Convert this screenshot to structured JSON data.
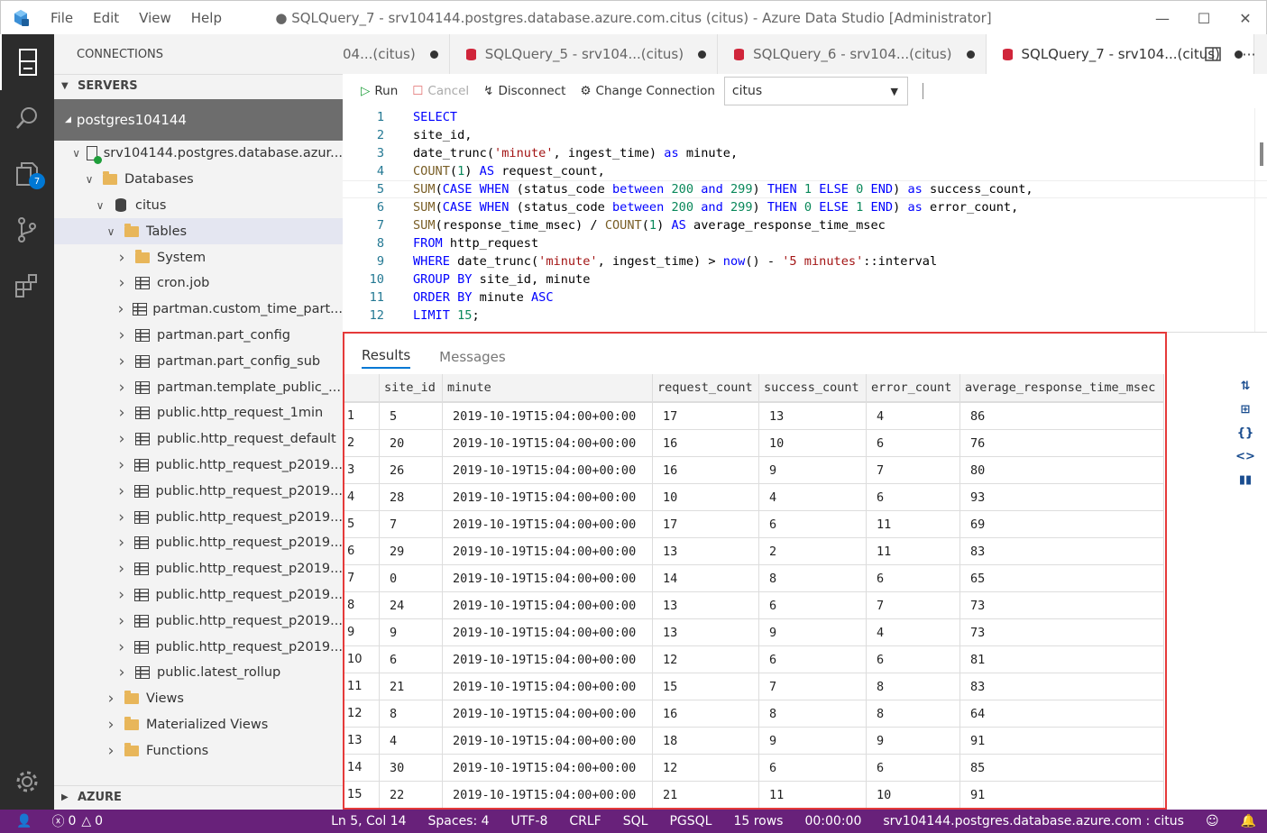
{
  "titlebar": {
    "menu": [
      "File",
      "Edit",
      "View",
      "Help"
    ],
    "title": "● SQLQuery_7 - srv104144.postgres.database.azure.com.citus (citus) - Azure Data Studio [Administrator]"
  },
  "activity": {
    "badge_count": "7"
  },
  "sidebar": {
    "header": "CONNECTIONS",
    "servers_label": "SERVERS",
    "server_group": "postgres104144",
    "tree": [
      {
        "label": "srv104144.postgres.database.azur...",
        "icon": "server-icon",
        "indent": 20,
        "twist": "expanded"
      },
      {
        "label": "Databases",
        "icon": "folder-icon",
        "indent": 32,
        "twist": "expanded"
      },
      {
        "label": "citus",
        "icon": "database-icon",
        "indent": 44,
        "twist": "expanded"
      },
      {
        "label": "Tables",
        "icon": "folder-icon",
        "indent": 56,
        "twist": "expanded",
        "selected": true
      },
      {
        "label": "System",
        "icon": "folder-icon",
        "indent": 68,
        "twist": "collapsed"
      },
      {
        "label": "cron.job",
        "icon": "table-icon",
        "indent": 68,
        "twist": "collapsed"
      },
      {
        "label": "partman.custom_time_part...",
        "icon": "table-icon",
        "indent": 68,
        "twist": "collapsed"
      },
      {
        "label": "partman.part_config",
        "icon": "table-icon",
        "indent": 68,
        "twist": "collapsed"
      },
      {
        "label": "partman.part_config_sub",
        "icon": "table-icon",
        "indent": 68,
        "twist": "collapsed"
      },
      {
        "label": "partman.template_public_...",
        "icon": "table-icon",
        "indent": 68,
        "twist": "collapsed"
      },
      {
        "label": "public.http_request_1min",
        "icon": "table-icon",
        "indent": 68,
        "twist": "collapsed"
      },
      {
        "label": "public.http_request_default",
        "icon": "table-icon",
        "indent": 68,
        "twist": "collapsed"
      },
      {
        "label": "public.http_request_p2019...",
        "icon": "table-icon",
        "indent": 68,
        "twist": "collapsed"
      },
      {
        "label": "public.http_request_p2019...",
        "icon": "table-icon",
        "indent": 68,
        "twist": "collapsed"
      },
      {
        "label": "public.http_request_p2019...",
        "icon": "table-icon",
        "indent": 68,
        "twist": "collapsed"
      },
      {
        "label": "public.http_request_p2019...",
        "icon": "table-icon",
        "indent": 68,
        "twist": "collapsed"
      },
      {
        "label": "public.http_request_p2019...",
        "icon": "table-icon",
        "indent": 68,
        "twist": "collapsed"
      },
      {
        "label": "public.http_request_p2019...",
        "icon": "table-icon",
        "indent": 68,
        "twist": "collapsed"
      },
      {
        "label": "public.http_request_p2019...",
        "icon": "table-icon",
        "indent": 68,
        "twist": "collapsed"
      },
      {
        "label": "public.http_request_p2019...",
        "icon": "table-icon",
        "indent": 68,
        "twist": "collapsed"
      },
      {
        "label": "public.latest_rollup",
        "icon": "table-icon",
        "indent": 68,
        "twist": "collapsed"
      },
      {
        "label": "Views",
        "icon": "folder-icon",
        "indent": 56,
        "twist": "collapsed"
      },
      {
        "label": "Materialized Views",
        "icon": "folder-icon",
        "indent": 56,
        "twist": "collapsed"
      },
      {
        "label": "Functions",
        "icon": "folder-icon",
        "indent": 56,
        "twist": "collapsed"
      }
    ],
    "azure_label": "AZURE"
  },
  "tabs": [
    {
      "label": "04...(citus)",
      "active": false,
      "partial": true
    },
    {
      "label": "SQLQuery_5 - srv104...(citus)",
      "active": false
    },
    {
      "label": "SQLQuery_6 - srv104...(citus)",
      "active": false
    },
    {
      "label": "SQLQuery_7 - srv104...(citus)",
      "active": true
    }
  ],
  "toolbar": {
    "run": "Run",
    "cancel": "Cancel",
    "disconnect": "Disconnect",
    "change_connection": "Change Connection",
    "database": "citus"
  },
  "editor": {
    "lines": [
      [
        [
          "kw",
          "SELECT"
        ]
      ],
      [
        [
          "t",
          "site_id,"
        ]
      ],
      [
        [
          "t",
          "date_trunc("
        ],
        [
          "str",
          "'minute'"
        ],
        [
          "t",
          ", ingest_time) "
        ],
        [
          "kw",
          "as"
        ],
        [
          "t",
          " minute,"
        ]
      ],
      [
        [
          "fn",
          "COUNT"
        ],
        [
          "t",
          "("
        ],
        [
          "num",
          "1"
        ],
        [
          "t",
          ") "
        ],
        [
          "kw",
          "AS"
        ],
        [
          "t",
          " request_count,"
        ]
      ],
      [
        [
          "fn",
          "SUM"
        ],
        [
          "t",
          "("
        ],
        [
          "kw",
          "CASE WHEN"
        ],
        [
          "t",
          " (status_code "
        ],
        [
          "kw",
          "between"
        ],
        [
          "t",
          " "
        ],
        [
          "num",
          "200"
        ],
        [
          "t",
          " "
        ],
        [
          "kw",
          "and"
        ],
        [
          "t",
          " "
        ],
        [
          "num",
          "299"
        ],
        [
          "t",
          ") "
        ],
        [
          "kw",
          "THEN"
        ],
        [
          "t",
          " "
        ],
        [
          "num",
          "1"
        ],
        [
          "t",
          " "
        ],
        [
          "kw",
          "ELSE"
        ],
        [
          "t",
          " "
        ],
        [
          "num",
          "0"
        ],
        [
          "t",
          " "
        ],
        [
          "kw",
          "END"
        ],
        [
          "t",
          ") "
        ],
        [
          "kw",
          "as"
        ],
        [
          "t",
          " success_count,"
        ]
      ],
      [
        [
          "fn",
          "SUM"
        ],
        [
          "t",
          "("
        ],
        [
          "kw",
          "CASE WHEN"
        ],
        [
          "t",
          " (status_code "
        ],
        [
          "kw",
          "between"
        ],
        [
          "t",
          " "
        ],
        [
          "num",
          "200"
        ],
        [
          "t",
          " "
        ],
        [
          "kw",
          "and"
        ],
        [
          "t",
          " "
        ],
        [
          "num",
          "299"
        ],
        [
          "t",
          ") "
        ],
        [
          "kw",
          "THEN"
        ],
        [
          "t",
          " "
        ],
        [
          "num",
          "0"
        ],
        [
          "t",
          " "
        ],
        [
          "kw",
          "ELSE"
        ],
        [
          "t",
          " "
        ],
        [
          "num",
          "1"
        ],
        [
          "t",
          " "
        ],
        [
          "kw",
          "END"
        ],
        [
          "t",
          ") "
        ],
        [
          "kw",
          "as"
        ],
        [
          "t",
          " error_count,"
        ]
      ],
      [
        [
          "fn",
          "SUM"
        ],
        [
          "t",
          "(response_time_msec) / "
        ],
        [
          "fn",
          "COUNT"
        ],
        [
          "t",
          "("
        ],
        [
          "num",
          "1"
        ],
        [
          "t",
          ") "
        ],
        [
          "kw",
          "AS"
        ],
        [
          "t",
          " average_response_time_msec"
        ]
      ],
      [
        [
          "kw",
          "FROM"
        ],
        [
          "t",
          " http_request"
        ]
      ],
      [
        [
          "kw",
          "WHERE"
        ],
        [
          "t",
          " date_trunc("
        ],
        [
          "str",
          "'minute'"
        ],
        [
          "t",
          ", ingest_time) > "
        ],
        [
          "kw",
          "now"
        ],
        [
          "t",
          "() - "
        ],
        [
          "str",
          "'5 minutes'"
        ],
        [
          "t",
          "::interval"
        ]
      ],
      [
        [
          "kw",
          "GROUP BY"
        ],
        [
          "t",
          " site_id, minute"
        ]
      ],
      [
        [
          "kw",
          "ORDER BY"
        ],
        [
          "t",
          " minute "
        ],
        [
          "kw",
          "ASC"
        ]
      ],
      [
        [
          "kw",
          "LIMIT"
        ],
        [
          "t",
          " "
        ],
        [
          "num",
          "15"
        ],
        [
          "t",
          ";"
        ]
      ]
    ]
  },
  "results": {
    "tabs": [
      "Results",
      "Messages"
    ],
    "columns": [
      "site_id",
      "minute",
      "request_count",
      "success_count",
      "error_count",
      "average_response_time_msec"
    ],
    "rows": [
      [
        "1",
        "5",
        "2019-10-19T15:04:00+00:00",
        "17",
        "13",
        "4",
        "86"
      ],
      [
        "2",
        "20",
        "2019-10-19T15:04:00+00:00",
        "16",
        "10",
        "6",
        "76"
      ],
      [
        "3",
        "26",
        "2019-10-19T15:04:00+00:00",
        "16",
        "9",
        "7",
        "80"
      ],
      [
        "4",
        "28",
        "2019-10-19T15:04:00+00:00",
        "10",
        "4",
        "6",
        "93"
      ],
      [
        "5",
        "7",
        "2019-10-19T15:04:00+00:00",
        "17",
        "6",
        "11",
        "69"
      ],
      [
        "6",
        "29",
        "2019-10-19T15:04:00+00:00",
        "13",
        "2",
        "11",
        "83"
      ],
      [
        "7",
        "0",
        "2019-10-19T15:04:00+00:00",
        "14",
        "8",
        "6",
        "65"
      ],
      [
        "8",
        "24",
        "2019-10-19T15:04:00+00:00",
        "13",
        "6",
        "7",
        "73"
      ],
      [
        "9",
        "9",
        "2019-10-19T15:04:00+00:00",
        "13",
        "9",
        "4",
        "73"
      ],
      [
        "10",
        "6",
        "2019-10-19T15:04:00+00:00",
        "12",
        "6",
        "6",
        "81"
      ],
      [
        "11",
        "21",
        "2019-10-19T15:04:00+00:00",
        "15",
        "7",
        "8",
        "83"
      ],
      [
        "12",
        "8",
        "2019-10-19T15:04:00+00:00",
        "16",
        "8",
        "8",
        "64"
      ],
      [
        "13",
        "4",
        "2019-10-19T15:04:00+00:00",
        "18",
        "9",
        "9",
        "91"
      ],
      [
        "14",
        "30",
        "2019-10-19T15:04:00+00:00",
        "12",
        "6",
        "6",
        "85"
      ],
      [
        "15",
        "22",
        "2019-10-19T15:04:00+00:00",
        "21",
        "11",
        "10",
        "91"
      ]
    ]
  },
  "statusbar": {
    "errors": "0",
    "warnings": "0",
    "position": "Ln 5, Col 14",
    "spaces": "Spaces: 4",
    "encoding": "UTF-8",
    "eol": "CRLF",
    "language": "SQL",
    "provider": "PGSQL",
    "rows": "15 rows",
    "time": "00:00:00",
    "connection": "srv104144.postgres.database.azure.com : citus"
  },
  "colors": {
    "statusbar": "#68217a",
    "activitybar": "#2c2c2c",
    "highlight_box": "#e53a3a",
    "accent": "#0078d4"
  }
}
